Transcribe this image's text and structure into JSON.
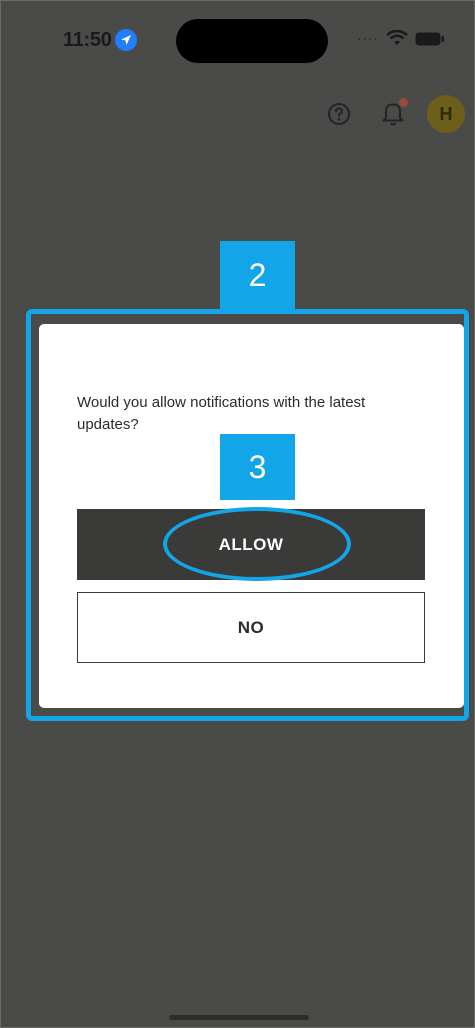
{
  "status_bar": {
    "time": "11:50",
    "location_icon": "location-arrow-icon",
    "signal_icon": "signal-dots-icon",
    "signal_text": "....",
    "wifi_icon": "wifi-icon",
    "battery_icon": "battery-icon"
  },
  "header": {
    "help_icon": "question-circle-icon",
    "notifications_icon": "bell-icon",
    "avatar_initial": "H"
  },
  "annotations": {
    "step_dialog": "2",
    "step_allow": "3",
    "highlight_color": "#12a6e8"
  },
  "dialog": {
    "message": "Would you allow notifications with the latest updates?",
    "allow_label": "ALLOW",
    "no_label": "NO"
  },
  "colors": {
    "overlay": "#4a4a48",
    "primary_button": "#3a3a38",
    "avatar": "#6b5f1a",
    "notification_dot": "#9a4a3a"
  }
}
